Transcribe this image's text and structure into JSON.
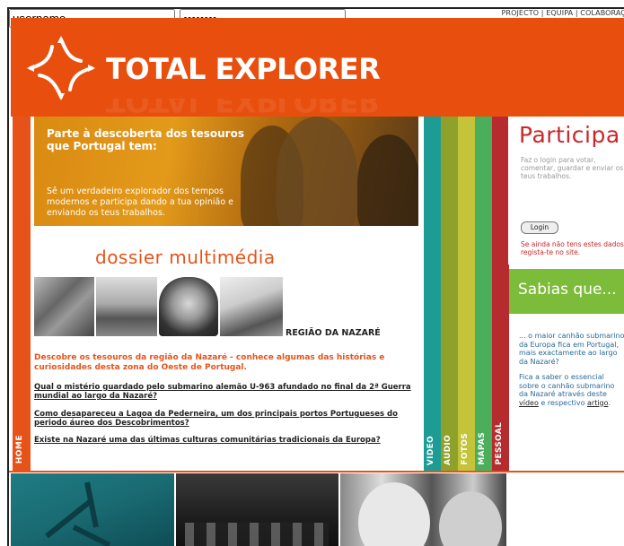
{
  "top_nav": {
    "links": [
      "PROJECTO",
      "EQUIPA",
      "COLABORAÇ"
    ],
    "separator": " | "
  },
  "header": {
    "brand": "TOTAL EXPLORER",
    "logo_icon": "compass-star-icon",
    "background_color": "#e84f0f"
  },
  "sections": {
    "home": "HOME",
    "tabs": [
      {
        "label": "VIDEO",
        "color": "#1d9c95"
      },
      {
        "label": "AUDIO",
        "color": "#8fa12a"
      },
      {
        "label": "FOTOS",
        "color": "#c4c43a"
      },
      {
        "label": "MAPAS",
        "color": "#4aae5a"
      },
      {
        "label": "PESSOAL",
        "color": "#b62c2e"
      }
    ]
  },
  "hero": {
    "title": "Parte à descoberta dos tesouros que Portugal tem:",
    "subtitle": "Sê um verdadeiro explorador dos tempos modernos e participa dando a tua opinião e enviando os teus trabalhos."
  },
  "dossier": {
    "heading": "dossier multimédia",
    "region_label": "REGIÃO DA NAZARÉ",
    "intro": "Descobre os tesouros da região da Nazaré - conhece algumas das histórias e curiosidades desta zona do Oeste de Portugal.",
    "questions": [
      "Qual o mistério guardado pelo submarino alemão U-963 afundado no final da 2ª Guerra mundial ao largo da Nazaré?",
      "Como desapareceu a Lagoa da Pederneira, um dos principais portos Portugueses do periodo áureo dos Descobrimentos?",
      "Existe na Nazaré uma das últimas culturas comunitárias tradicionais da Europa?"
    ]
  },
  "participa": {
    "title": "Participa",
    "description": "Faz o login para votar, comentar, guardar e enviar os teus trabalhos.",
    "username_value": "username",
    "password_value": "••••••••",
    "login_label": "Login",
    "register_note": "Se ainda não tens estes dados, regista-te no site."
  },
  "sabias": {
    "title": "Sabias que...",
    "fact1": "... o maior canhão submarino da Europa fica em Portugal, mais exactamente ao largo da Nazaré?",
    "fact2_prefix": "Fica a saber o essencial sobre o canhão submarino da Nazaré através deste",
    "fact2_link1": "vídeo",
    "fact2_mid": " e respectivo ",
    "fact2_link2": "artigo",
    "fact2_end": "."
  }
}
